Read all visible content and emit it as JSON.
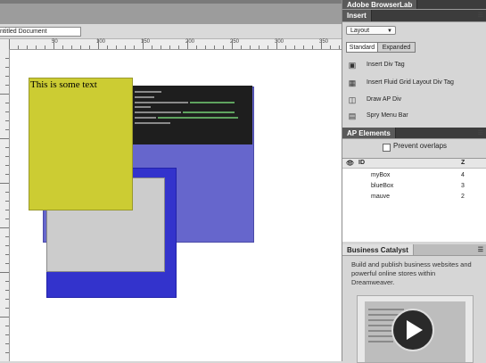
{
  "document": {
    "tab_title": "ntitled Document",
    "ruler_labels": [
      "50",
      "100",
      "150",
      "200",
      "250",
      "300",
      "350"
    ],
    "boxes": {
      "mybox_text": "This is some text",
      "mybox_color": "#cccc33",
      "mauve_color": "#6666cc",
      "blue_color": "#3333cc",
      "gray_color": "#cccccc"
    }
  },
  "panels": {
    "browserlab": {
      "title": "Adobe BrowserLab"
    },
    "insert": {
      "title": "Insert",
      "category": "Layout",
      "tabs": [
        "Standard",
        "Expanded"
      ],
      "items": [
        {
          "label": "Insert Div Tag",
          "icon": "div-tag-icon"
        },
        {
          "label": "Insert Fluid Grid Layout Div Tag",
          "icon": "fluid-grid-icon"
        },
        {
          "label": "Draw AP Div",
          "icon": "ap-div-icon"
        },
        {
          "label": "Spry Menu Bar",
          "icon": "menu-bar-icon"
        }
      ]
    },
    "ap_elements": {
      "title": "AP Elements",
      "prevent_overlaps": "Prevent overlaps",
      "col_id": "ID",
      "col_z": "Z",
      "rows": [
        {
          "id": "myBox",
          "z": "4"
        },
        {
          "id": "blueBox",
          "z": "3"
        },
        {
          "id": "mauve",
          "z": "2"
        }
      ]
    },
    "business_catalyst": {
      "title": "Business Catalyst",
      "blurb": "Build and publish business websites and powerful online stores within Dreamweaver."
    }
  }
}
